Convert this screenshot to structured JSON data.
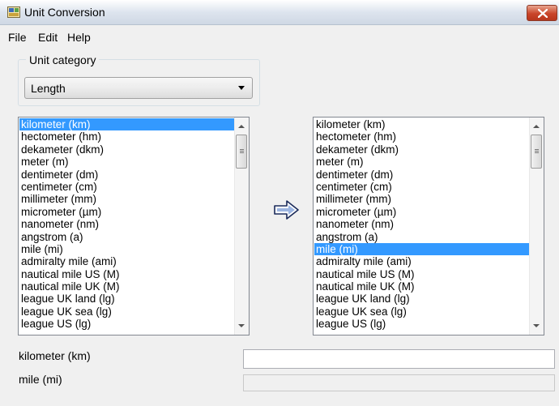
{
  "window": {
    "title": "Unit Conversion"
  },
  "menu": {
    "items": [
      "File",
      "Edit",
      "Help"
    ]
  },
  "category": {
    "group_label": "Unit category",
    "selected": "Length"
  },
  "units": [
    "kilometer (km)",
    "hectometer (hm)",
    "dekameter (dkm)",
    "meter (m)",
    "dentimeter (dm)",
    "centimeter (cm)",
    "millimeter (mm)",
    "micrometer (µm)",
    "nanometer (nm)",
    "angstrom (a)",
    "mile (mi)",
    "admiralty mile (ami)",
    "nautical mile US (M)",
    "nautical mile UK (M)",
    "league UK land (lg)",
    "league UK sea (lg)",
    "league US (lg)"
  ],
  "source_list": {
    "selected_index": 0
  },
  "target_list": {
    "selected_index": 10
  },
  "convert_arrow": {
    "icon": "right-arrow-icon"
  },
  "input_field": {
    "label": "kilometer (km)",
    "value": ""
  },
  "output_field": {
    "label": "mile (mi)",
    "value": ""
  },
  "colors": {
    "selection": "#3399ff",
    "window_bg": "#f0f0f0",
    "close_button": "#c9452a",
    "arrow_fill": "#4a78c8"
  }
}
